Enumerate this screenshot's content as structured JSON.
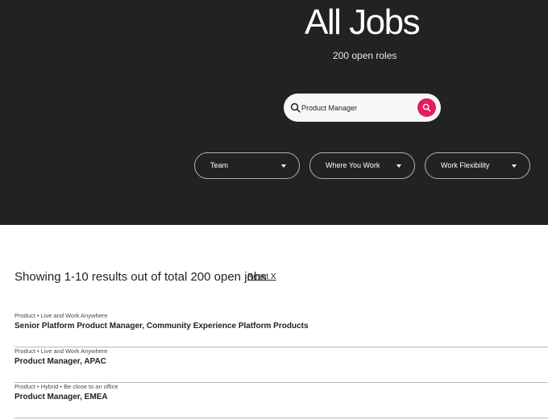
{
  "hero": {
    "title": "All Jobs",
    "subtitle": "200 open roles",
    "background": "#222222"
  },
  "search": {
    "value": "Product Manager",
    "icon": "search-icon",
    "button_icon": "search-icon",
    "button_color": "#e31c5f"
  },
  "filters": [
    {
      "label": "Team",
      "icon": "chevron-down-icon"
    },
    {
      "label": "Where You Work",
      "icon": "chevron-down-icon"
    },
    {
      "label": "Work Flexibility",
      "icon": "chevron-down-icon"
    }
  ],
  "results": {
    "heading": "Showing 1-10 results out of total 200 open jobs",
    "reset_label": "Reset X"
  },
  "jobs": [
    {
      "meta": "Product • Live and Work Anywhere",
      "title": "Senior Platform Product Manager, Community Experience Platform Products"
    },
    {
      "meta": "Product • Live and Work Anywhere",
      "title": "Product Manager, APAC"
    },
    {
      "meta": "Product • Hybrid • Be close to an office",
      "title": "Product Manager, EMEA"
    }
  ]
}
